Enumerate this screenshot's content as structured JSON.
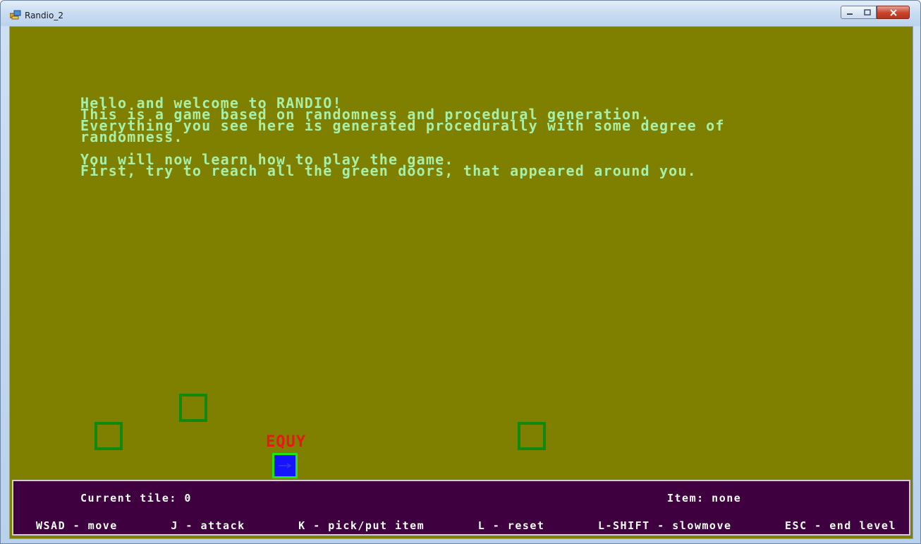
{
  "window": {
    "title": "Randio_2"
  },
  "intro": {
    "lines_block1": [
      "Hello and welcome to RANDIO!",
      "This is a game based on randomness and procedural generation.",
      "Everything you see here is generated procedurally with some degree of",
      "randomness."
    ],
    "lines_block2": [
      "You will now learn how to play the game.",
      "First, try to reach all the green doors, that appeared around you."
    ]
  },
  "player": {
    "label": "EQUY",
    "facing_icon": "arrow-right-icon"
  },
  "hud": {
    "current_tile": "Current tile: 0",
    "item": "Item: none",
    "controls": [
      "WSAD - move",
      "J - attack",
      "K - pick/put item",
      "L - reset",
      "L-SHIFT - slowmove",
      "ESC - end level"
    ]
  },
  "colors": {
    "background": "#7f7f00",
    "text": "#a8f0a8",
    "door": "#0f8a0f",
    "player_fill": "#1414ff",
    "player_border": "#18e818",
    "player_label": "#e81818",
    "hud_background": "#3f003f"
  }
}
